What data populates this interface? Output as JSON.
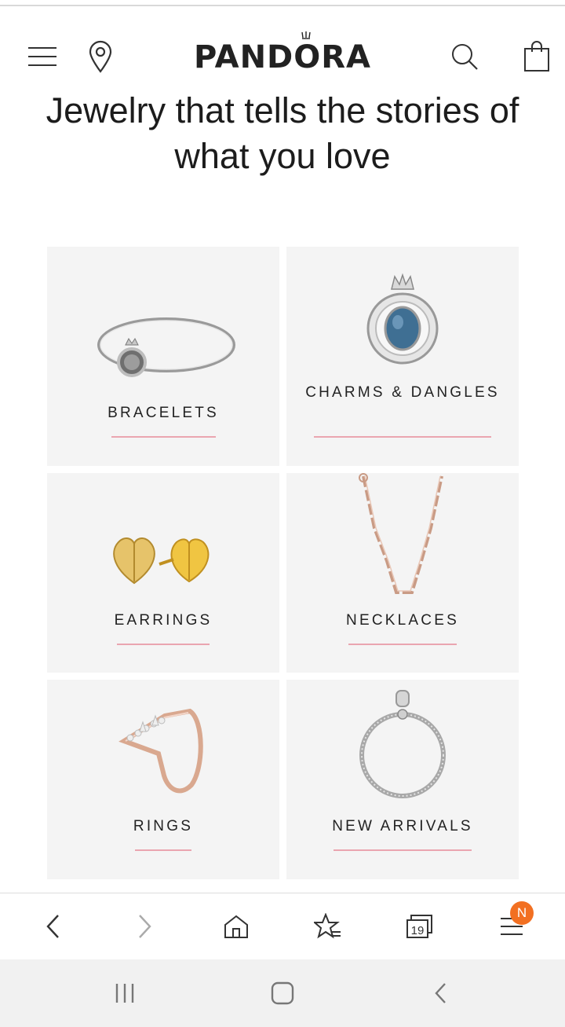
{
  "header": {
    "logo_text": "PANDORA",
    "menu_icon": "hamburger-menu-icon",
    "location_icon": "store-locator-pin-icon",
    "search_icon": "search-icon",
    "bag_icon": "shopping-bag-icon"
  },
  "hero": {
    "title": "Jewelry that tells the stories of what you love"
  },
  "categories": [
    {
      "label": "BRACELETS",
      "icon": "bracelet-image"
    },
    {
      "label": "CHARMS & DANGLES",
      "icon": "charm-image"
    },
    {
      "label": "EARRINGS",
      "icon": "earrings-image"
    },
    {
      "label": "NECKLACES",
      "icon": "necklace-image"
    },
    {
      "label": "RINGS",
      "icon": "ring-image"
    },
    {
      "label": "NEW ARRIVALS",
      "icon": "new-arrivals-bracelet-image"
    }
  ],
  "browser_toolbar": {
    "back_icon": "back-arrow-icon",
    "forward_icon": "forward-arrow-icon",
    "home_icon": "home-icon",
    "bookmarks_icon": "bookmark-star-icon",
    "tabs_count": "19",
    "menu_badge": "N"
  },
  "colors": {
    "underline": "#eaa5b0",
    "tile_bg": "#f4f4f4",
    "badge": "#f27022"
  }
}
